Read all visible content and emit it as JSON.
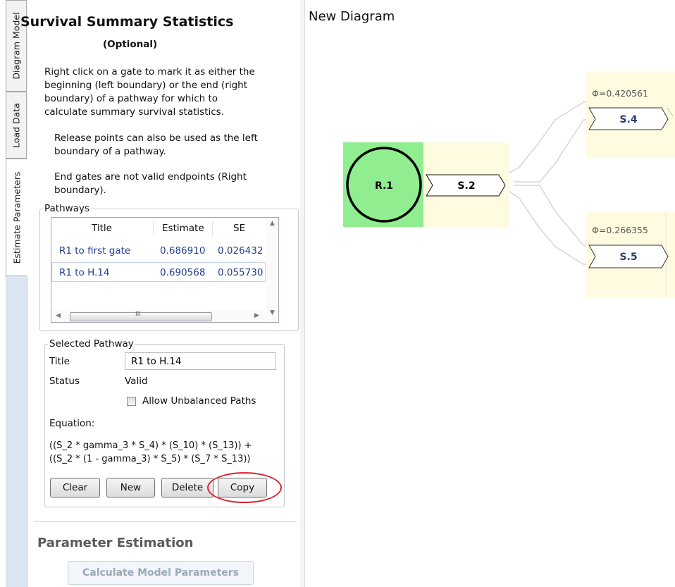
{
  "tabs": [
    {
      "label": "Diagram Model"
    },
    {
      "label": "Load Data"
    },
    {
      "label": "Estimate Parameters"
    }
  ],
  "panel": {
    "title": "Survival Summary Statistics",
    "subtitle": "(Optional)",
    "instructions": [
      "Right click on a gate to mark it as either the",
      "beginning (left boundary) or the end (right",
      "boundary) of a pathway for which to",
      "calculate summary survival statistics."
    ],
    "note1": [
      "Release points can also be used as the left",
      "boundary of a pathway."
    ],
    "note2": [
      "End gates are not valid endpoints (Right",
      "boundary)."
    ],
    "pathways": {
      "legend": "Pathways",
      "columns": [
        "Title",
        "Estimate",
        "SE"
      ],
      "rows": [
        {
          "title": "R1 to first gate",
          "estimate": "0.686910",
          "se": "0.026432"
        },
        {
          "title": "R1 to H.14",
          "estimate": "0.690568",
          "se": "0.055730"
        }
      ],
      "scroll_glyph": "III"
    },
    "selected": {
      "legend": "Selected Pathway",
      "title_label": "Title",
      "title_value": "R1 to H.14",
      "status_label": "Status",
      "status_value": "Valid",
      "allow_unbalanced_label": "Allow Unbalanced Paths",
      "allow_unbalanced_checked": false,
      "equation_label": "Equation:",
      "equation_lines": [
        "((S_2 * gamma_3 * S_4) * (S_10) * (S_13)) +",
        "((S_2 * (1 - gamma_3) * S_5) * (S_7 * S_13))"
      ]
    },
    "buttons": {
      "clear": "Clear",
      "new": "New",
      "delete": "Delete",
      "copy": "Copy"
    },
    "estimation": {
      "title": "Parameter Estimation",
      "calculate": "Calculate Model Parameters"
    }
  },
  "diagram": {
    "title": "New Diagram",
    "release": "R.1",
    "gates": [
      "S.2",
      "S.4",
      "S.5"
    ],
    "phi_s4": "Φ=0.420561",
    "phi_s5": "Φ=0.266355"
  },
  "colors": {
    "release_bg": "#90ee90",
    "gate_bg": "#fffbe0",
    "highlight": "#d9262e",
    "link": "#233f8c"
  }
}
